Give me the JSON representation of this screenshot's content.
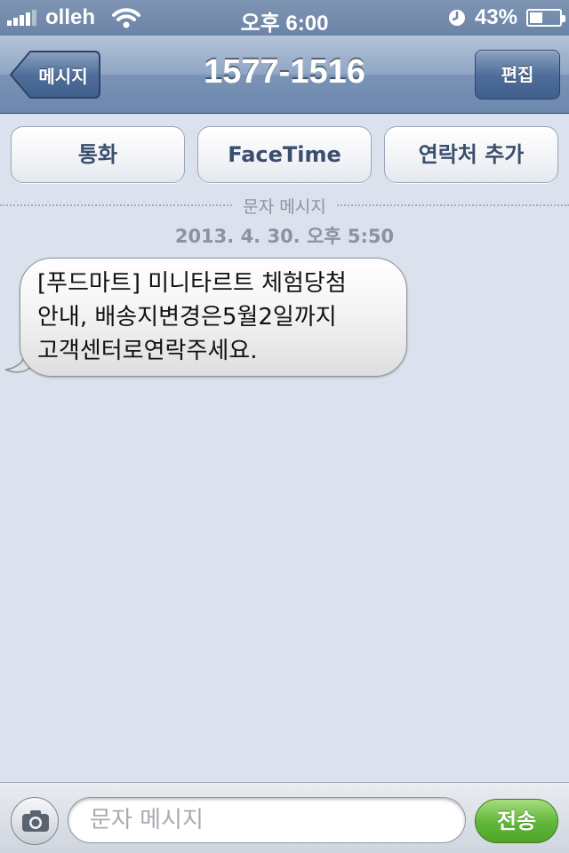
{
  "status_bar": {
    "carrier": "olleh",
    "time": "오후 6:00",
    "battery_percent_label": "43%",
    "battery_level": 0.43,
    "icons": [
      "signal-icon",
      "wifi-icon",
      "clock-icon",
      "battery-icon"
    ]
  },
  "nav": {
    "back_label": "메시지",
    "title": "1577-1516",
    "edit_label": "편집"
  },
  "actions": {
    "call_label": "통화",
    "facetime_label": "FaceTime",
    "add_contact_label": "연락처 추가"
  },
  "thread": {
    "section_label": "문자 메시지",
    "timestamp": "2013. 4. 30. 오후 5:50",
    "messages": [
      {
        "direction": "incoming",
        "text": "[푸드마트] 미니타르트 체험당첨\n안내, 배송지변경은5월2일까지\n고객센터로연락주세요."
      }
    ]
  },
  "composer": {
    "placeholder": "문자 메시지",
    "value": "",
    "send_label": "전송",
    "camera_icon": "camera-icon"
  },
  "colors": {
    "background": "#dbe2ed",
    "navbar": "#6d88ae",
    "send_button": "#62b83a"
  }
}
